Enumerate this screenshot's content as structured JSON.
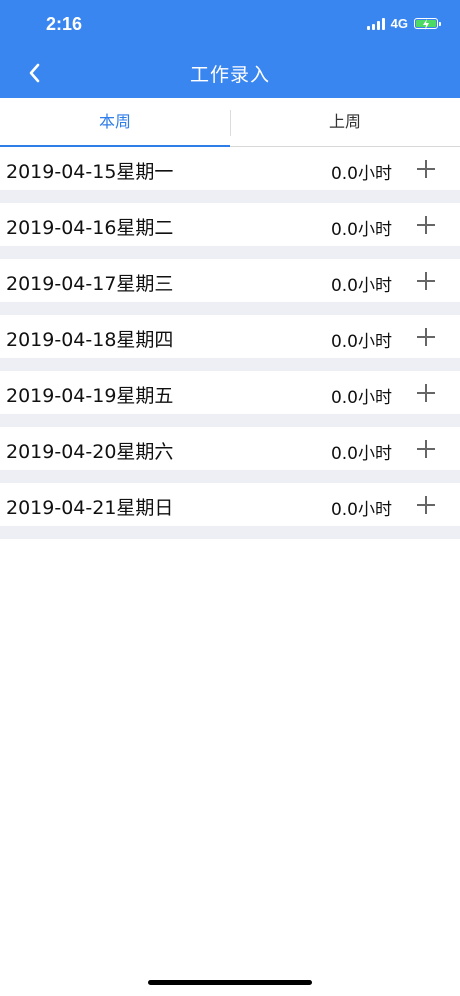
{
  "status_bar": {
    "time": "2:16",
    "network": "4G"
  },
  "nav": {
    "title": "工作录入"
  },
  "tabs": [
    {
      "label": "本周",
      "active": true
    },
    {
      "label": "上周",
      "active": false
    }
  ],
  "entries": [
    {
      "date": "2019-04-15星期一",
      "hours": "0.0小时"
    },
    {
      "date": "2019-04-16星期二",
      "hours": "0.0小时"
    },
    {
      "date": "2019-04-17星期三",
      "hours": "0.0小时"
    },
    {
      "date": "2019-04-18星期四",
      "hours": "0.0小时"
    },
    {
      "date": "2019-04-19星期五",
      "hours": "0.0小时"
    },
    {
      "date": "2019-04-20星期六",
      "hours": "0.0小时"
    },
    {
      "date": "2019-04-21星期日",
      "hours": "0.0小时"
    }
  ],
  "colors": {
    "header": "#3a86f0",
    "active_tab": "#2f7ee8",
    "separator": "#eeeff4"
  },
  "icons": {
    "back": "chevron-left-icon",
    "add": "plus-icon",
    "battery": "battery-charging-icon",
    "signal": "signal-bars-icon"
  }
}
